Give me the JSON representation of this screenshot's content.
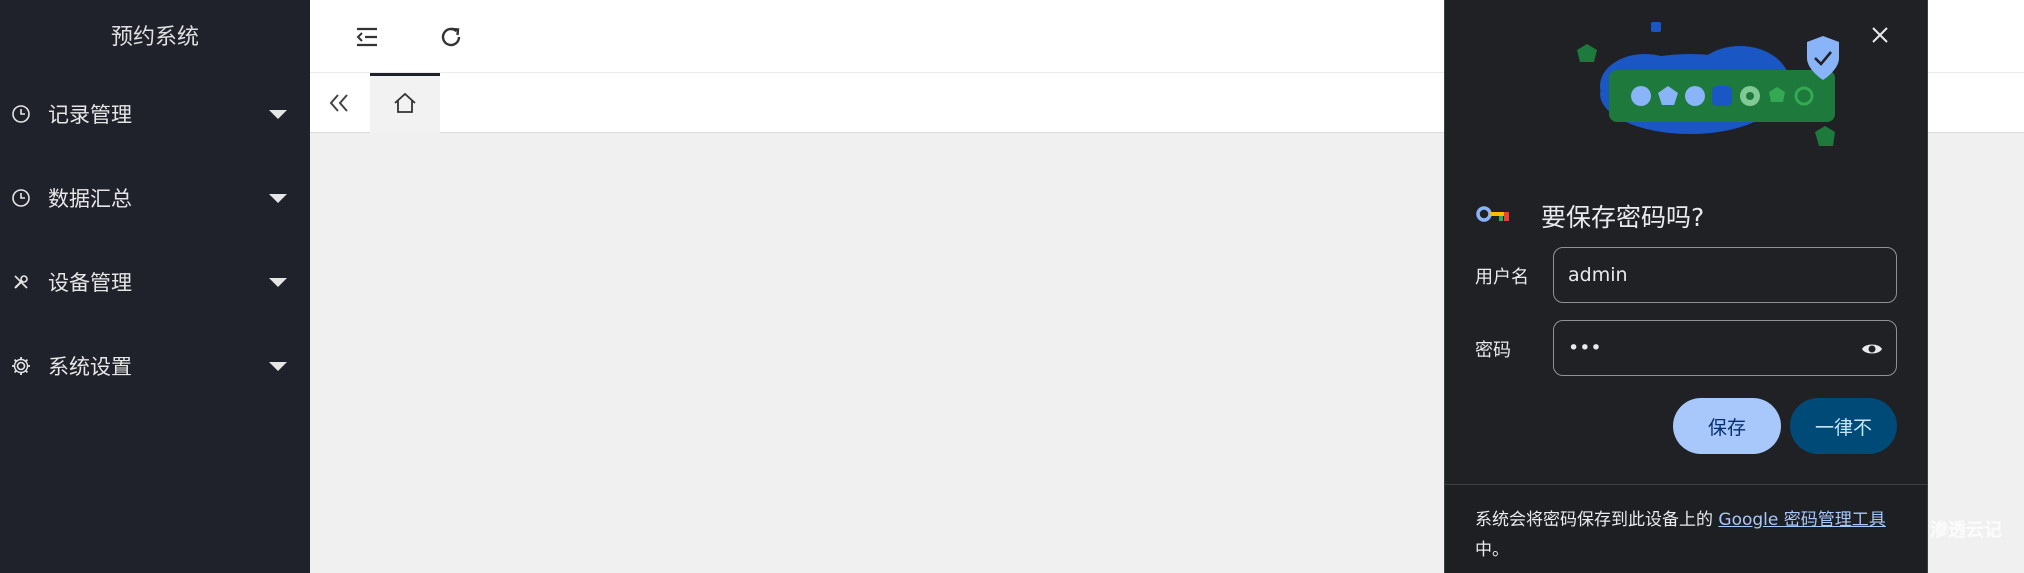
{
  "app": {
    "title": "预约系统"
  },
  "sidebar": {
    "items": [
      {
        "label": "记录管理",
        "icon": "clock-icon"
      },
      {
        "label": "数据汇总",
        "icon": "clock-icon"
      },
      {
        "label": "设备管理",
        "icon": "tools-icon"
      },
      {
        "label": "系统设置",
        "icon": "gear-icon"
      }
    ]
  },
  "header": {
    "menu_icon": "menu-fold-icon",
    "refresh_icon": "refresh-icon"
  },
  "tabs": {
    "collapse_icon": "double-chevron-left-icon",
    "home_icon": "home-icon"
  },
  "password_dialog": {
    "title": "要保存密码吗?",
    "username_label": "用户名",
    "username_value": "admin",
    "password_label": "密码",
    "password_value": "•••",
    "save_label": "保存",
    "never_label": "一律不",
    "footer_text": "系统会将密码保存到此设备上的 ",
    "footer_link": "Google 密码管理工具",
    "footer_end": "中。"
  },
  "watermark": "渗透云记",
  "colors": {
    "sidebar_bg": "#1f222b",
    "dialog_bg": "#202124",
    "save_btn": "#a8c7fa",
    "never_btn": "#004a77"
  }
}
